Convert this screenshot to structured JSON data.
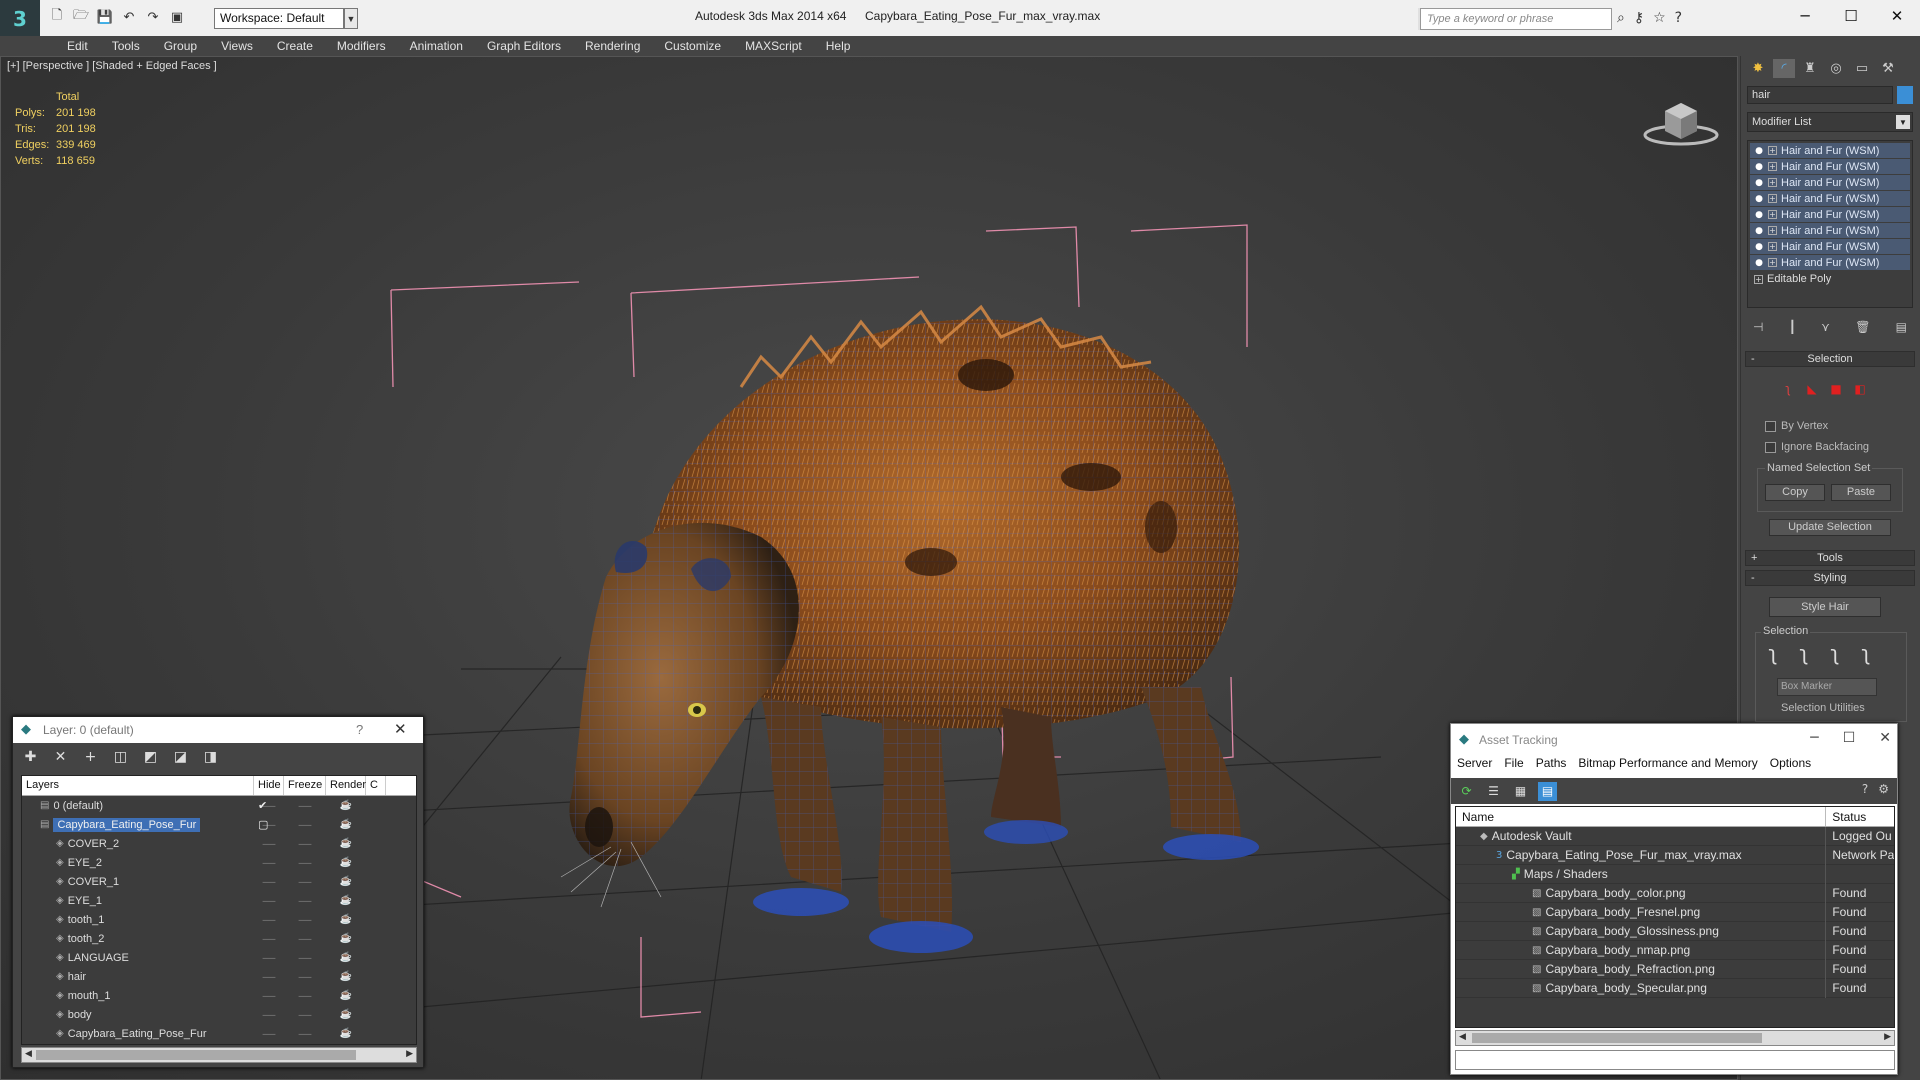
{
  "title_bar": {
    "app_title": "Autodesk 3ds Max  2014 x64",
    "file_title": "Capybara_Eating_Pose_Fur_max_vray.max",
    "workspace": "Workspace: Default",
    "search_placeholder": "Type a keyword or phrase",
    "quick_access_icons": [
      "new-file-icon",
      "open-file-icon",
      "save-icon",
      "undo-icon",
      "redo-icon",
      "project-icon"
    ],
    "help_icons": [
      "binoculars-icon",
      "key-icon",
      "star-icon",
      "help-icon"
    ]
  },
  "menu": [
    "Edit",
    "Tools",
    "Group",
    "Views",
    "Create",
    "Modifiers",
    "Animation",
    "Graph Editors",
    "Rendering",
    "Customize",
    "MAXScript",
    "Help"
  ],
  "viewport": {
    "label": "[+] [Perspective ] [Shaded + Edged Faces ]",
    "stats": {
      "header": "Total",
      "rows": [
        {
          "label": "Polys:",
          "value": "201 198"
        },
        {
          "label": "Tris:",
          "value": "201 198"
        },
        {
          "label": "Edges:",
          "value": "339 469"
        },
        {
          "label": "Verts:",
          "value": "118 659"
        }
      ]
    }
  },
  "command_panel": {
    "tabs": [
      "create-icon",
      "modify-icon",
      "hierarchy-icon",
      "motion-icon",
      "display-icon",
      "utilities-icon"
    ],
    "object_name": "hair",
    "object_color": "#3b8fd6",
    "modifier_list_label": "Modifier List",
    "stack": [
      "Hair and Fur (WSM)",
      "Hair and Fur (WSM)",
      "Hair and Fur (WSM)",
      "Hair and Fur (WSM)",
      "Hair and Fur (WSM)",
      "Hair and Fur (WSM)",
      "Hair and Fur (WSM)",
      "Hair and Fur (WSM)"
    ],
    "base_object": "Editable Poly",
    "selection_rollout": "Selection",
    "by_vertex": "By Vertex",
    "ignore_backfacing": "Ignore Backfacing",
    "named_selection_set": "Named Selection Set",
    "copy_label": "Copy",
    "paste_label": "Paste",
    "update_selection": "Update Selection",
    "tools_rollout": "Tools",
    "styling_rollout": "Styling",
    "style_hair": "Style Hair",
    "styling_selection": "Selection",
    "box_marker": "Box Marker",
    "selection_utilities": "Selection Utilities"
  },
  "layer_panel": {
    "title": "Layer: 0 (default)",
    "help": "?",
    "toolbar_icons": [
      "new-layer-icon",
      "delete-layer-icon",
      "add-to-layer-icon",
      "select-in-layer-icon",
      "highlight-layer-icon",
      "hide-all-icon",
      "freeze-all-icon"
    ],
    "columns": [
      "Layers",
      "Hide",
      "Freeze",
      "Render",
      "C"
    ],
    "rows": [
      {
        "name": "0 (default)",
        "level": 0,
        "flag": "✔",
        "selected": false
      },
      {
        "name": "Capybara_Eating_Pose_Fur",
        "level": 0,
        "flag": "▢",
        "selected": true
      },
      {
        "name": "COVER_2",
        "level": 1,
        "flag": "",
        "selected": false
      },
      {
        "name": "EYE_2",
        "level": 1,
        "flag": "",
        "selected": false
      },
      {
        "name": "COVER_1",
        "level": 1,
        "flag": "",
        "selected": false
      },
      {
        "name": "EYE_1",
        "level": 1,
        "flag": "",
        "selected": false
      },
      {
        "name": "tooth_1",
        "level": 1,
        "flag": "",
        "selected": false
      },
      {
        "name": "tooth_2",
        "level": 1,
        "flag": "",
        "selected": false
      },
      {
        "name": "LANGUAGE",
        "level": 1,
        "flag": "",
        "selected": false
      },
      {
        "name": "hair",
        "level": 1,
        "flag": "",
        "selected": false
      },
      {
        "name": "mouth_1",
        "level": 1,
        "flag": "",
        "selected": false
      },
      {
        "name": "body",
        "level": 1,
        "flag": "",
        "selected": false
      },
      {
        "name": "Capybara_Eating_Pose_Fur",
        "level": 1,
        "flag": "",
        "selected": false
      }
    ]
  },
  "asset_tracking": {
    "title": "Asset Tracking",
    "menu": [
      "Server",
      "File",
      "Paths",
      "Bitmap Performance and Memory",
      "Options"
    ],
    "columns": {
      "name": "Name",
      "status": "Status"
    },
    "rows": [
      {
        "name": "Autodesk Vault",
        "status": "Logged Ou",
        "level": 0,
        "icon": "vault-icon"
      },
      {
        "name": "Capybara_Eating_Pose_Fur_max_vray.max",
        "status": "Network Pa",
        "level": 1,
        "icon": "max-file-icon"
      },
      {
        "name": "Maps / Shaders",
        "status": "",
        "level": 2,
        "icon": "maps-icon"
      },
      {
        "name": "Capybara_body_color.png",
        "status": "Found",
        "level": 3,
        "icon": "bitmap-icon"
      },
      {
        "name": "Capybara_body_Fresnel.png",
        "status": "Found",
        "level": 3,
        "icon": "bitmap-icon"
      },
      {
        "name": "Capybara_body_Glossiness.png",
        "status": "Found",
        "level": 3,
        "icon": "bitmap-icon"
      },
      {
        "name": "Capybara_body_nmap.png",
        "status": "Found",
        "level": 3,
        "icon": "bitmap-icon"
      },
      {
        "name": "Capybara_body_Refraction.png",
        "status": "Found",
        "level": 3,
        "icon": "bitmap-icon"
      },
      {
        "name": "Capybara_body_Specular.png",
        "status": "Found",
        "level": 3,
        "icon": "bitmap-icon"
      }
    ]
  }
}
